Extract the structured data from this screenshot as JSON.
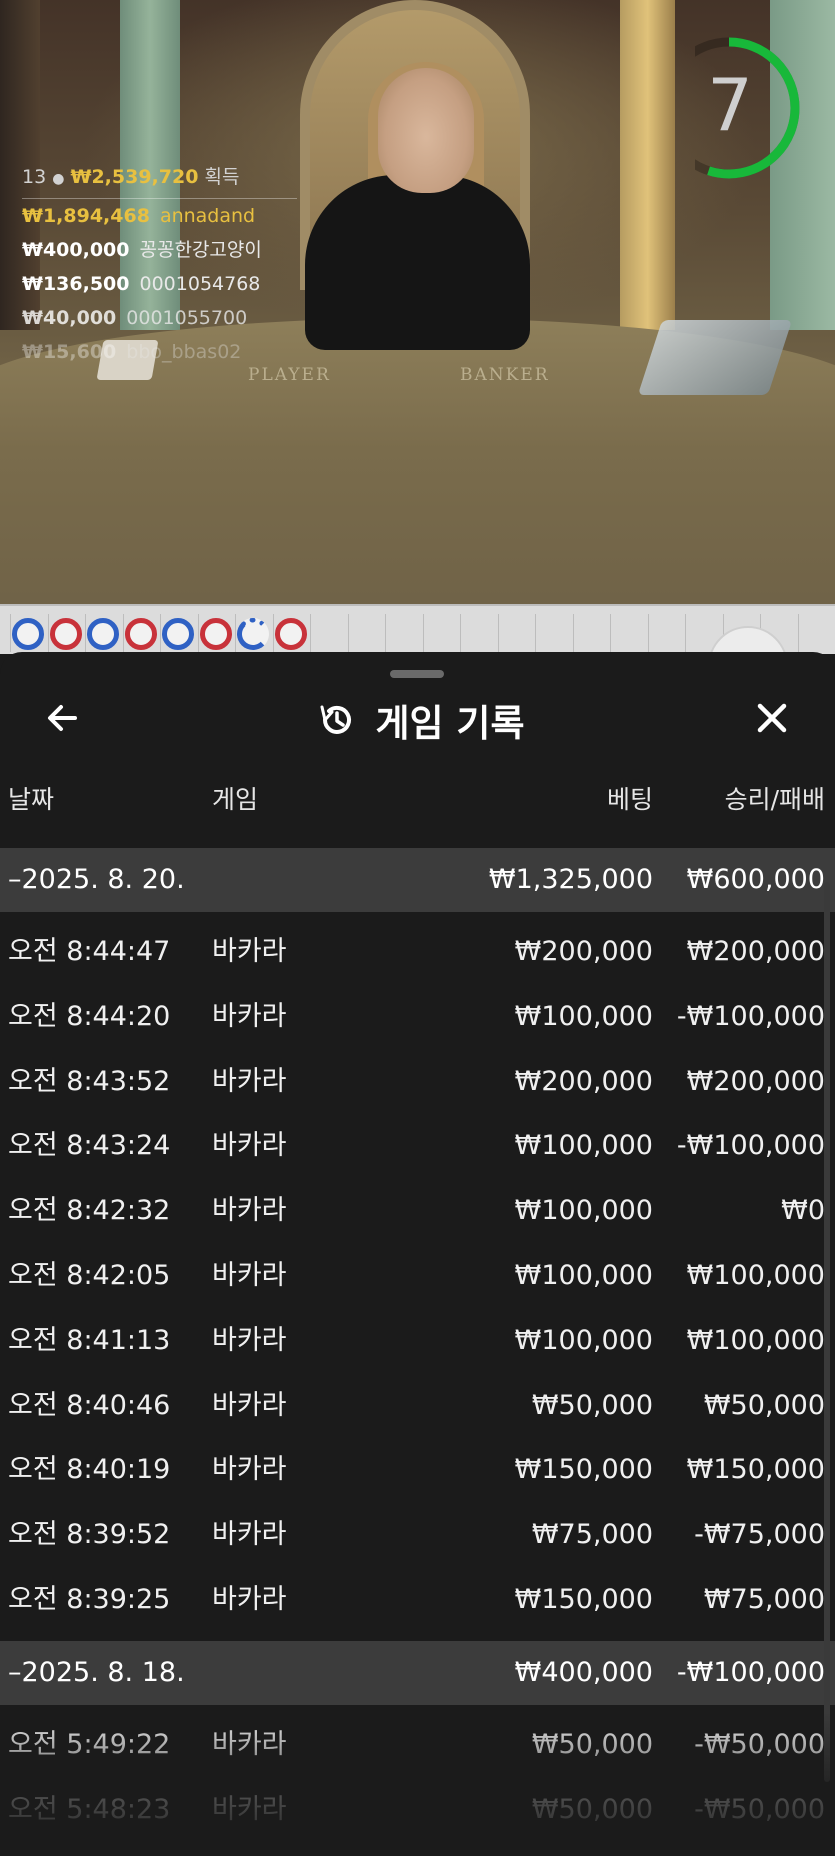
{
  "stream": {
    "table_labels": [
      "PLAYER",
      "BANKER"
    ],
    "timer": "7",
    "timer_fraction": 0.55,
    "leaderboard": {
      "count": "13",
      "total": "₩2,539,720",
      "total_suffix": "획득",
      "winners": [
        {
          "amount": "₩1,894,468",
          "name": "annadand",
          "color": "#e8c040"
        },
        {
          "amount": "₩400,000",
          "name": "꽁꽁한강고양이",
          "color": "#ffffff"
        },
        {
          "amount": "₩136,500",
          "name": "0001054768",
          "color": "#ffffff"
        },
        {
          "amount": "₩40,000",
          "name": "0001055700",
          "color": "#ffffff"
        },
        {
          "amount": "₩15,600",
          "name": "bbo_bbas02",
          "color": "#ffffff"
        }
      ]
    },
    "bead_road": [
      "blue",
      "red",
      "blue",
      "red",
      "blue",
      "red",
      "blue-open",
      "red"
    ]
  },
  "panel": {
    "title": "게임 기록",
    "icons": {
      "back": "arrow-left-icon",
      "history": "history-icon",
      "close": "close-icon"
    },
    "columns": {
      "date": "날짜",
      "game": "게임",
      "bet": "베팅",
      "result": "승리/패배"
    },
    "groups": [
      {
        "date": "–2025. 8. 20.",
        "bet": "₩1,325,000",
        "result": "₩600,000",
        "rows": [
          {
            "time": "오전 8:44:47",
            "game": "바카라",
            "bet": "₩200,000",
            "result": "₩200,000"
          },
          {
            "time": "오전 8:44:20",
            "game": "바카라",
            "bet": "₩100,000",
            "result": "-₩100,000"
          },
          {
            "time": "오전 8:43:52",
            "game": "바카라",
            "bet": "₩200,000",
            "result": "₩200,000"
          },
          {
            "time": "오전 8:43:24",
            "game": "바카라",
            "bet": "₩100,000",
            "result": "-₩100,000"
          },
          {
            "time": "오전 8:42:32",
            "game": "바카라",
            "bet": "₩100,000",
            "result": "₩0"
          },
          {
            "time": "오전 8:42:05",
            "game": "바카라",
            "bet": "₩100,000",
            "result": "₩100,000"
          },
          {
            "time": "오전 8:41:13",
            "game": "바카라",
            "bet": "₩100,000",
            "result": "₩100,000"
          },
          {
            "time": "오전 8:40:46",
            "game": "바카라",
            "bet": "₩50,000",
            "result": "₩50,000"
          },
          {
            "time": "오전 8:40:19",
            "game": "바카라",
            "bet": "₩150,000",
            "result": "₩150,000"
          },
          {
            "time": "오전 8:39:52",
            "game": "바카라",
            "bet": "₩75,000",
            "result": "-₩75,000"
          },
          {
            "time": "오전 8:39:25",
            "game": "바카라",
            "bet": "₩150,000",
            "result": "₩75,000"
          }
        ]
      },
      {
        "date": "–2025. 8. 18.",
        "bet": "₩400,000",
        "result": "-₩100,000",
        "rows": [
          {
            "time": "오전 5:49:22",
            "game": "바카라",
            "bet": "₩50,000",
            "result": "-₩50,000"
          },
          {
            "time": "오전 5:48:23",
            "game": "바카라",
            "bet": "₩50,000",
            "result": "-₩50,000"
          }
        ]
      }
    ]
  }
}
